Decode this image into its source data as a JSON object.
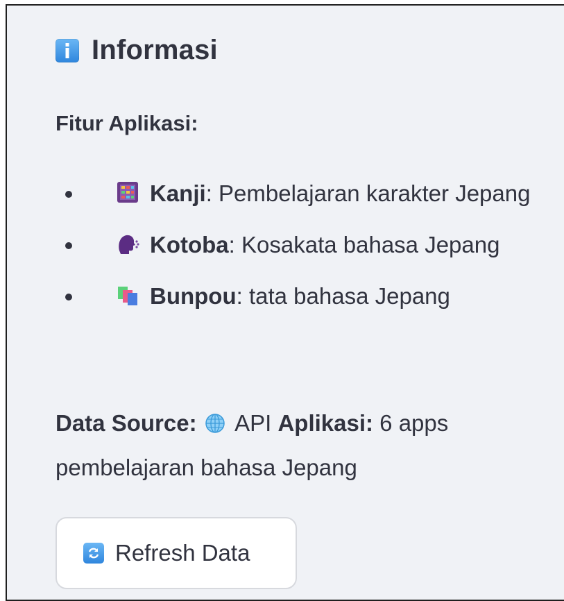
{
  "header": {
    "icon": "information-icon",
    "title": "Informasi"
  },
  "features": {
    "heading": "Fitur Aplikasi:",
    "items": [
      {
        "icon": "abacus-icon",
        "term": "Kanji",
        "sep": ":",
        "desc": " Pembelajaran karakter Jepang"
      },
      {
        "icon": "speaking-head-icon",
        "term": "Kotoba",
        "sep": ":",
        "desc": " Kosakata bahasa Jepang"
      },
      {
        "icon": "books-icon",
        "term": "Bunpou",
        "sep": ":",
        "desc": " tata bahasa Jepang"
      }
    ]
  },
  "datasource": {
    "label": "Data Source:",
    "icon": "globe-icon",
    "api_text": " API ",
    "apps_label": "Aplikasi:",
    "apps_value": " 6 apps pembelajaran bahasa Jepang"
  },
  "refresh_button": {
    "icon": "refresh-icon",
    "label": "Refresh Data"
  },
  "colors": {
    "panel_bg": "#f0f2f6",
    "text": "#31333f",
    "icon_blue": "#2f86dd"
  }
}
